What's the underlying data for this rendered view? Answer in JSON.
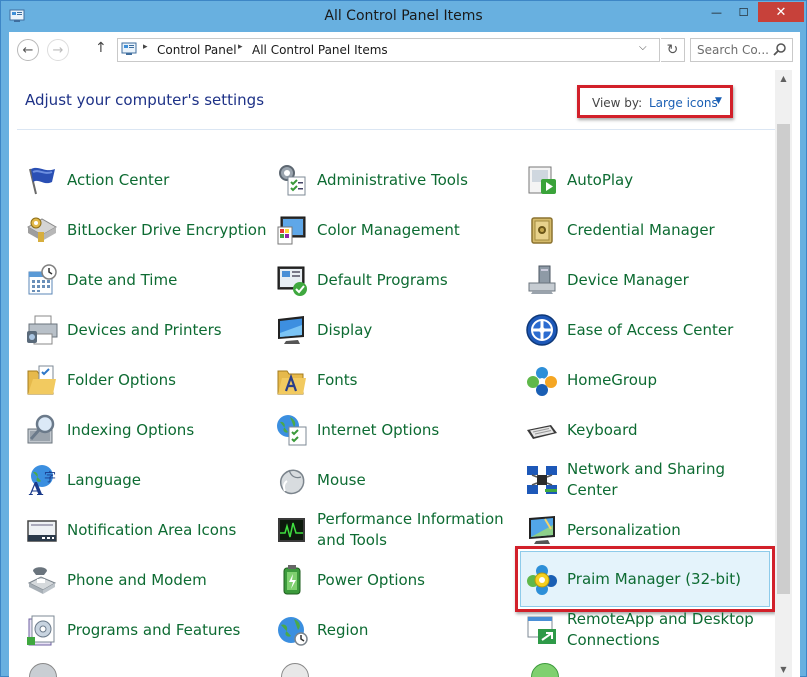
{
  "window": {
    "title": "All Control Panel Items",
    "controls": {
      "minimize": "—",
      "maximize": "☐",
      "close": "✕"
    }
  },
  "navigation": {
    "back": "←",
    "forward": "→",
    "up": "↑",
    "breadcrumbs": [
      "Control Panel",
      "All Control Panel Items"
    ],
    "breadcrumb_separator": "▸",
    "dropdown": "⌵",
    "refresh": "↻",
    "search_placeholder": "Search Co..."
  },
  "header": {
    "title": "Adjust your computer's settings",
    "view_by_label": "View by:",
    "view_by_value": "Large icons",
    "view_by_caret": "▼"
  },
  "items": [
    {
      "label": "Action Center",
      "icon": "flag-icon"
    },
    {
      "label": "Administrative Tools",
      "icon": "admin-tools-icon"
    },
    {
      "label": "AutoPlay",
      "icon": "autoplay-icon"
    },
    {
      "label": "BitLocker Drive Encryption",
      "icon": "bitlocker-icon"
    },
    {
      "label": "Color Management",
      "icon": "color-management-icon"
    },
    {
      "label": "Credential Manager",
      "icon": "credential-manager-icon"
    },
    {
      "label": "Date and Time",
      "icon": "calendar-clock-icon"
    },
    {
      "label": "Default Programs",
      "icon": "default-programs-icon"
    },
    {
      "label": "Device Manager",
      "icon": "device-manager-icon"
    },
    {
      "label": "Devices and Printers",
      "icon": "printer-icon"
    },
    {
      "label": "Display",
      "icon": "display-icon"
    },
    {
      "label": "Ease of Access Center",
      "icon": "ease-of-access-icon"
    },
    {
      "label": "Folder Options",
      "icon": "folder-options-icon"
    },
    {
      "label": "Fonts",
      "icon": "fonts-icon"
    },
    {
      "label": "HomeGroup",
      "icon": "homegroup-icon"
    },
    {
      "label": "Indexing Options",
      "icon": "indexing-icon"
    },
    {
      "label": "Internet Options",
      "icon": "internet-options-icon"
    },
    {
      "label": "Keyboard",
      "icon": "keyboard-icon"
    },
    {
      "label": "Language",
      "icon": "language-icon"
    },
    {
      "label": "Mouse",
      "icon": "mouse-icon"
    },
    {
      "label": "Network and Sharing Center",
      "icon": "network-icon"
    },
    {
      "label": "Notification Area Icons",
      "icon": "notification-area-icon"
    },
    {
      "label": "Performance Information and Tools",
      "icon": "performance-icon"
    },
    {
      "label": "Personalization",
      "icon": "personalization-icon"
    },
    {
      "label": "Phone and Modem",
      "icon": "phone-modem-icon"
    },
    {
      "label": "Power Options",
      "icon": "power-options-icon"
    },
    {
      "label": "Praim Manager (32-bit)",
      "icon": "praim-manager-icon"
    },
    {
      "label": "Programs and Features",
      "icon": "programs-features-icon"
    },
    {
      "label": "Region",
      "icon": "region-icon"
    },
    {
      "label": "RemoteApp and Desktop Connections",
      "icon": "remoteapp-icon"
    }
  ],
  "scrollbar": {
    "up": "▲",
    "down": "▼"
  },
  "colors": {
    "link_green": "#0d6b32",
    "heading_blue": "#1e3287",
    "highlight_red": "#d2202a",
    "selection_bg": "#e4f3fb"
  }
}
